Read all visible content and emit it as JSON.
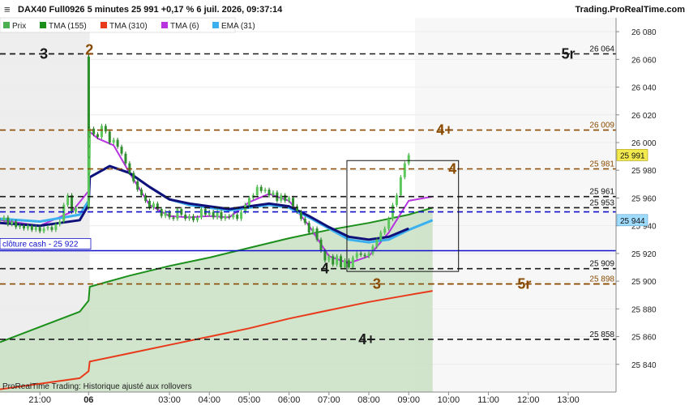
{
  "header": {
    "title": "DAX40 Full0926 5 minutes 25 991 +0,17 % 6 juil. 2026, 09:37:14",
    "source": "Trading.ProRealTime.com"
  },
  "legend": [
    {
      "label": "Prix",
      "color": "#4caf50",
      "icon": "price-swatch"
    },
    {
      "label": "TMA (155)",
      "color": "#1a8f1a",
      "icon": "tma155-swatch"
    },
    {
      "label": "TMA (310)",
      "color": "#e83a1a",
      "icon": "tma310-swatch"
    },
    {
      "label": "TMA (6)",
      "color": "#b833e0",
      "icon": "tma6-swatch"
    },
    {
      "label": "EMA (31)",
      "color": "#3ab0f0",
      "icon": "ema31-swatch"
    }
  ],
  "footer_text": "ProRealTime Trading: Historique ajusté aux rollovers",
  "chart_data": {
    "type": "line",
    "title": "",
    "ylim": [
      25820,
      26090
    ],
    "y_ticks": [
      25840,
      25860,
      25880,
      25900,
      25920,
      25940,
      25960,
      25980,
      26000,
      26020,
      26040,
      26060,
      26080
    ],
    "y_tick_labels": [
      "25 840",
      "25 860",
      "25 880",
      "25 900",
      "25 920",
      "25 940",
      "25 960",
      "25 980",
      "26 000",
      "26 020",
      "26 040",
      "26 060",
      "26 080"
    ],
    "x_labels": [
      "21:00",
      "06",
      "03:00",
      "04:00",
      "05:00",
      "06:00",
      "07:00",
      "08:00",
      "09:00",
      "10:00",
      "11:00",
      "12:00",
      "13:00"
    ],
    "x_hours": [
      21,
      30,
      33,
      34,
      35,
      36,
      37,
      38,
      39,
      40,
      41,
      42,
      43
    ],
    "x_bold_labels": [
      "06"
    ],
    "x_range_hours": [
      20.0,
      44.2
    ],
    "session_gap": {
      "before_hour": 22.0,
      "after_hour": 31.0
    },
    "last_price": {
      "value": 25991,
      "label": "25 991",
      "color": "#f2e94e"
    },
    "ema_tag": {
      "value": 25944,
      "label": "25 944",
      "color": "#9fdcff"
    },
    "cash_close": {
      "value": 25922,
      "label": "clôture cash -  25 922",
      "color": "#1010cc"
    },
    "levels": [
      {
        "value": 26064,
        "label": "26 064",
        "text": "5r",
        "text_hour": 43.0,
        "color": "#1a1a1a",
        "style": "dash"
      },
      {
        "value": 26064,
        "label": "",
        "text": "3",
        "text_hour": 21.1,
        "color": "#1a1a1a",
        "style": "dash",
        "start_hour": 20.0,
        "end_hour": 22.0
      },
      {
        "value": 26009,
        "label": "26 009",
        "text": "4+",
        "text_hour": 39.9,
        "color": "#8a4a00",
        "style": "dash"
      },
      {
        "value": 25981,
        "label": "25 981",
        "text": "4",
        "text_hour": 40.1,
        "color": "#8a4a00",
        "style": "dash"
      },
      {
        "value": 25961,
        "label": "25 961",
        "text": "",
        "color": "#1a1a1a",
        "style": "dash"
      },
      {
        "value": 25953,
        "label": "25 953",
        "text": "",
        "color": "#1a1a1a",
        "style": "dash"
      },
      {
        "value": 25950,
        "label": "",
        "text": "",
        "color": "#1010cc",
        "style": "dash"
      },
      {
        "value": 25909,
        "label": "25 909",
        "text": "4",
        "text_hour": 36.9,
        "color": "#1a1a1a",
        "style": "dash"
      },
      {
        "value": 25898,
        "label": "25 898",
        "text": "3",
        "text_hour": 38.2,
        "color": "#8a4a00",
        "style": "dash"
      },
      {
        "value": 25898,
        "label": "",
        "text": "5r",
        "text_hour": 41.9,
        "color": "#8a4a00",
        "style": "dash",
        "start_hour": 39.5,
        "end_hour": 44.2
      },
      {
        "value": 25858,
        "label": "25 858",
        "text": "4+",
        "text_hour": 37.95,
        "color": "#1a1a1a",
        "style": "dash"
      }
    ],
    "extra_level_text": [
      {
        "text": "2",
        "value": 26064,
        "hour": 30.7,
        "color": "#8a4a00"
      }
    ],
    "box": {
      "hour_start": 37.45,
      "hour_end": 40.25,
      "top": 25987,
      "bottom": 25907
    },
    "price": [
      [
        20.0,
        25944
      ],
      [
        20.1,
        25946
      ],
      [
        20.2,
        25941
      ],
      [
        20.3,
        25943
      ],
      [
        20.4,
        25939
      ],
      [
        20.5,
        25940
      ],
      [
        20.6,
        25938
      ],
      [
        20.7,
        25940
      ],
      [
        20.8,
        25937
      ],
      [
        20.9,
        25939
      ],
      [
        21.0,
        25936
      ],
      [
        21.1,
        25938
      ],
      [
        21.2,
        25939
      ],
      [
        21.3,
        25937
      ],
      [
        21.4,
        25941
      ],
      [
        21.5,
        25943
      ],
      [
        21.6,
        25955
      ],
      [
        21.7,
        25962
      ],
      [
        21.8,
        25950
      ],
      [
        21.9,
        25953
      ],
      [
        30.0,
        25960
      ],
      [
        30.05,
        26062
      ],
      [
        30.1,
        26010
      ],
      [
        30.15,
        26005
      ],
      [
        30.2,
        25995
      ],
      [
        30.3,
        25990
      ],
      [
        30.4,
        25982
      ],
      [
        30.5,
        25978
      ],
      [
        30.6,
        25990
      ],
      [
        30.7,
        25998
      ],
      [
        30.8,
        26005
      ],
      [
        30.9,
        26008
      ],
      [
        31.0,
        26010
      ],
      [
        31.1,
        26006
      ],
      [
        31.2,
        26004
      ],
      [
        31.3,
        26012
      ],
      [
        31.4,
        26008
      ],
      [
        31.5,
        26000
      ],
      [
        31.6,
        26002
      ],
      [
        31.7,
        25997
      ],
      [
        31.8,
        25992
      ],
      [
        31.9,
        25985
      ],
      [
        32.0,
        25978
      ],
      [
        32.1,
        25972
      ],
      [
        32.2,
        25966
      ],
      [
        32.3,
        25962
      ],
      [
        32.4,
        25958
      ],
      [
        32.5,
        25953
      ],
      [
        32.6,
        25956
      ],
      [
        32.7,
        25952
      ],
      [
        32.8,
        25947
      ],
      [
        32.9,
        25950
      ],
      [
        33.0,
        25946
      ],
      [
        33.1,
        25945
      ],
      [
        33.2,
        25952
      ],
      [
        33.3,
        25948
      ],
      [
        33.4,
        25945
      ],
      [
        33.5,
        25947
      ],
      [
        33.6,
        25944
      ],
      [
        33.7,
        25946
      ],
      [
        33.8,
        25952
      ],
      [
        33.9,
        25948
      ],
      [
        34.0,
        25950
      ],
      [
        34.1,
        25946
      ],
      [
        34.2,
        25950
      ],
      [
        34.3,
        25945
      ],
      [
        34.4,
        25947
      ],
      [
        34.5,
        25946
      ],
      [
        34.6,
        25948
      ],
      [
        34.7,
        25945
      ],
      [
        34.8,
        25950
      ],
      [
        34.9,
        25955
      ],
      [
        35.0,
        25960
      ],
      [
        35.1,
        25962
      ],
      [
        35.2,
        25968
      ],
      [
        35.3,
        25965
      ],
      [
        35.4,
        25966
      ],
      [
        35.5,
        25962
      ],
      [
        35.6,
        25964
      ],
      [
        35.7,
        25958
      ],
      [
        35.8,
        25962
      ],
      [
        35.9,
        25958
      ],
      [
        36.0,
        25960
      ],
      [
        36.1,
        25954
      ],
      [
        36.2,
        25950
      ],
      [
        36.3,
        25945
      ],
      [
        36.4,
        25942
      ],
      [
        36.5,
        25935
      ],
      [
        36.6,
        25938
      ],
      [
        36.7,
        25930
      ],
      [
        36.8,
        25922
      ],
      [
        36.9,
        25915
      ],
      [
        37.0,
        25918
      ],
      [
        37.1,
        25912
      ],
      [
        37.2,
        25918
      ],
      [
        37.3,
        25910
      ],
      [
        37.4,
        25915
      ],
      [
        37.5,
        25910
      ],
      [
        37.6,
        25917
      ],
      [
        37.7,
        25920
      ],
      [
        37.8,
        25919
      ],
      [
        37.9,
        25918
      ],
      [
        38.0,
        25920
      ],
      [
        38.1,
        25925
      ],
      [
        38.2,
        25930
      ],
      [
        38.3,
        25935
      ],
      [
        38.4,
        25938
      ],
      [
        38.5,
        25945
      ],
      [
        38.6,
        25955
      ],
      [
        38.7,
        25962
      ],
      [
        38.8,
        25975
      ],
      [
        38.9,
        25985
      ],
      [
        39.0,
        25991
      ]
    ],
    "series": [
      {
        "name": "TMA (155)",
        "color": "#1a8f1a",
        "fill": "#c9dfc3",
        "values": [
          [
            20.0,
            25856
          ],
          [
            21.0,
            25867
          ],
          [
            22.0,
            25878
          ],
          [
            30.0,
            25886
          ],
          [
            31.0,
            25896
          ],
          [
            32.0,
            25904
          ],
          [
            33.0,
            25911
          ],
          [
            34.0,
            25917
          ],
          [
            35.0,
            25924
          ],
          [
            36.0,
            25931
          ],
          [
            37.0,
            25937
          ],
          [
            38.0,
            25942
          ],
          [
            39.0,
            25948
          ],
          [
            39.6,
            25953
          ]
        ]
      },
      {
        "name": "TMA (310)",
        "color": "#e83a1a",
        "values": [
          [
            20.0,
            25822
          ],
          [
            21.0,
            25826
          ],
          [
            22.0,
            25830
          ],
          [
            30.0,
            25835
          ],
          [
            31.0,
            25842
          ],
          [
            32.0,
            25848
          ],
          [
            33.0,
            25854
          ],
          [
            34.0,
            25860
          ],
          [
            35.0,
            25866
          ],
          [
            36.0,
            25873
          ],
          [
            37.0,
            25879
          ],
          [
            38.0,
            25885
          ],
          [
            39.0,
            25890
          ],
          [
            39.6,
            25893
          ]
        ]
      },
      {
        "name": "TMA (6)",
        "color": "#b833e0",
        "values": [
          [
            20.0,
            25944
          ],
          [
            21.0,
            25940
          ],
          [
            21.8,
            25950
          ],
          [
            30.0,
            25965
          ],
          [
            30.3,
            26000
          ],
          [
            30.7,
            26008
          ],
          [
            31.2,
            26003
          ],
          [
            31.6,
            25998
          ],
          [
            32.0,
            25978
          ],
          [
            32.5,
            25955
          ],
          [
            33.0,
            25947
          ],
          [
            33.5,
            25946
          ],
          [
            34.0,
            25947
          ],
          [
            34.5,
            25946
          ],
          [
            35.0,
            25957
          ],
          [
            35.5,
            25963
          ],
          [
            36.0,
            25958
          ],
          [
            36.5,
            25940
          ],
          [
            37.0,
            25918
          ],
          [
            37.5,
            25913
          ],
          [
            38.0,
            25918
          ],
          [
            38.5,
            25935
          ],
          [
            39.0,
            25958
          ],
          [
            39.6,
            25961
          ]
        ]
      },
      {
        "name": "EMA (31)",
        "color": "#3ab0f0",
        "values": [
          [
            20.0,
            25945
          ],
          [
            21.0,
            25943
          ],
          [
            22.0,
            25948
          ],
          [
            30.0,
            25958
          ],
          [
            31.0,
            25975
          ],
          [
            31.5,
            25983
          ],
          [
            32.0,
            25978
          ],
          [
            32.5,
            25968
          ],
          [
            33.0,
            25959
          ],
          [
            33.5,
            25955
          ],
          [
            34.0,
            25953
          ],
          [
            34.5,
            25951
          ],
          [
            35.0,
            25953
          ],
          [
            35.5,
            25955
          ],
          [
            36.0,
            25953
          ],
          [
            36.5,
            25946
          ],
          [
            37.0,
            25938
          ],
          [
            37.5,
            25930
          ],
          [
            38.0,
            25928
          ],
          [
            38.5,
            25930
          ],
          [
            39.0,
            25937
          ],
          [
            39.6,
            25944
          ]
        ]
      },
      {
        "name": "",
        "color": "#10107a",
        "values": [
          [
            20.0,
            25942
          ],
          [
            21.0,
            25940
          ],
          [
            22.0,
            25944
          ],
          [
            30.0,
            25955
          ],
          [
            31.0,
            25975
          ],
          [
            31.5,
            25983
          ],
          [
            32.0,
            25978
          ],
          [
            32.5,
            25968
          ],
          [
            33.0,
            25959
          ],
          [
            33.5,
            25956
          ],
          [
            34.0,
            25954
          ],
          [
            34.5,
            25952
          ],
          [
            35.0,
            25954
          ],
          [
            35.5,
            25956
          ],
          [
            36.0,
            25954
          ],
          [
            36.5,
            25947
          ],
          [
            37.0,
            25939
          ],
          [
            37.5,
            25932
          ],
          [
            38.0,
            25930
          ],
          [
            38.5,
            25932
          ],
          [
            39.0,
            25938
          ]
        ]
      }
    ]
  }
}
